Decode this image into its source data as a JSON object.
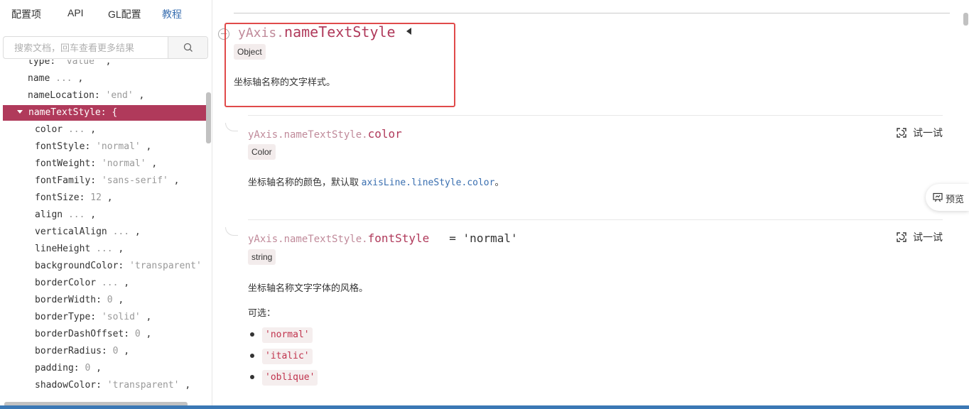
{
  "nav": {
    "items": [
      {
        "label": "配置项"
      },
      {
        "label": "API"
      },
      {
        "label": "GL配置"
      },
      {
        "label": "教程"
      }
    ]
  },
  "search": {
    "placeholder": "搜索文档，回车查看更多结果",
    "icon": "search-icon"
  },
  "tree": {
    "rows": [
      {
        "key": "type",
        "sep": ": ",
        "val": "'value'",
        "tail": " ,"
      },
      {
        "key": "name",
        "sep": " ",
        "val": "...",
        "tail": " ,"
      },
      {
        "key": "nameLocation",
        "sep": ": ",
        "val": "'end'",
        "tail": " ,"
      },
      {
        "key": "nameTextStyle",
        "sep": ": ",
        "val": "{",
        "tail": ""
      },
      {
        "key": "color",
        "sep": " ",
        "val": "...",
        "tail": " ,"
      },
      {
        "key": "fontStyle",
        "sep": ": ",
        "val": "'normal'",
        "tail": " ,"
      },
      {
        "key": "fontWeight",
        "sep": ": ",
        "val": "'normal'",
        "tail": " ,"
      },
      {
        "key": "fontFamily",
        "sep": ": ",
        "val": "'sans-serif'",
        "tail": " ,"
      },
      {
        "key": "fontSize",
        "sep": ": ",
        "val": "12",
        "tail": " ,"
      },
      {
        "key": "align",
        "sep": " ",
        "val": "...",
        "tail": " ,"
      },
      {
        "key": "verticalAlign",
        "sep": " ",
        "val": "...",
        "tail": " ,"
      },
      {
        "key": "lineHeight",
        "sep": " ",
        "val": "...",
        "tail": " ,"
      },
      {
        "key": "backgroundColor",
        "sep": ": ",
        "val": "'transparent'",
        "tail": ""
      },
      {
        "key": "borderColor",
        "sep": " ",
        "val": "...",
        "tail": " ,"
      },
      {
        "key": "borderWidth",
        "sep": ": ",
        "val": "0",
        "tail": " ,"
      },
      {
        "key": "borderType",
        "sep": ": ",
        "val": "'solid'",
        "tail": " ,"
      },
      {
        "key": "borderDashOffset",
        "sep": ": ",
        "val": "0",
        "tail": " ,"
      },
      {
        "key": "borderRadius",
        "sep": ": ",
        "val": "0",
        "tail": " ,"
      },
      {
        "key": "padding",
        "sep": ": ",
        "val": "0",
        "tail": " ,"
      },
      {
        "key": "shadowColor",
        "sep": ": ",
        "val": "'transparent'",
        "tail": " ,"
      }
    ]
  },
  "main": {
    "section1": {
      "prefix": "yAxis.",
      "name": "nameTextStyle",
      "type": "Object",
      "desc": "坐标轴名称的文字样式。"
    },
    "section2": {
      "prefix": "yAxis.nameTextStyle.",
      "name": "color",
      "type": "Color",
      "desc_before": "坐标轴名称的颜色，默认取 ",
      "desc_code": "axisLine.lineStyle.color",
      "desc_after": "。",
      "try_label": "试一试"
    },
    "section3": {
      "prefix": "yAxis.nameTextStyle.",
      "name": "fontStyle",
      "default": "= 'normal'",
      "type": "string",
      "desc": "坐标轴名称文字字体的风格。",
      "options_label": "可选：",
      "options": [
        "'normal'",
        "'italic'",
        "'oblique'"
      ],
      "try_label": "试一试"
    }
  },
  "preview": {
    "label": "预览"
  },
  "colors": {
    "accent": "#b03a5b",
    "link": "#3a6fb0",
    "highlight_box": "#e04a4a"
  }
}
